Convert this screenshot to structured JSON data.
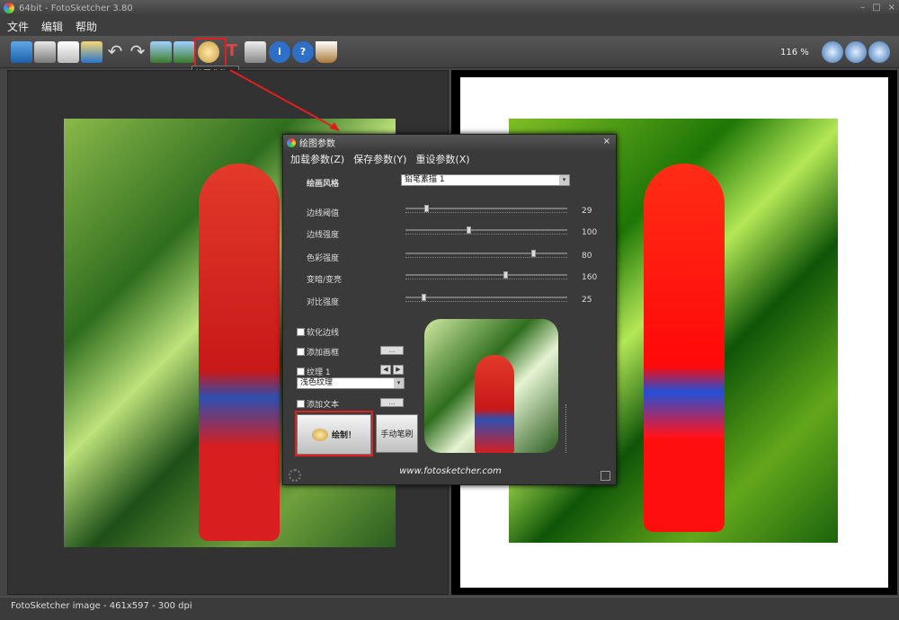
{
  "window": {
    "title": "64bit - FotoSketcher 3.80",
    "minimize": "–",
    "maximize": "□",
    "close": "×"
  },
  "menu": [
    "文件",
    "编辑",
    "帮助"
  ],
  "toolbar": {
    "buttons": [
      "open-icon",
      "save-icon",
      "copy-icon",
      "paste-icon",
      "undo-icon",
      "redo-icon",
      "image-left-icon",
      "image-right-icon",
      "paint-params-icon",
      "text-icon",
      "print-icon",
      "info-icon",
      "help-icon",
      "coffee-icon"
    ],
    "tooltip": "绘图参数...",
    "zoom_label": "116 %",
    "zoom_buttons": [
      "zoom-in-icon",
      "zoom-fit-icon",
      "zoom-out-icon"
    ]
  },
  "status": {
    "text": "FotoSketcher image - 461x597 - 300 dpi"
  },
  "dialog": {
    "title": "绘图参数",
    "close": "×",
    "menu": [
      "加载参数(Z)",
      "保存参数(Y)",
      "重设参数(X)"
    ],
    "style_label": "绘画风格",
    "style_value": "铅笔素描 1",
    "sliders": [
      {
        "label": "边线阈值",
        "value": "29",
        "position": 0.12
      },
      {
        "label": "边线强度",
        "value": "100",
        "position": 0.39
      },
      {
        "label": "色彩强度",
        "value": "80",
        "position": 0.8
      },
      {
        "label": "变暗/变亮",
        "value": "160",
        "position": 0.62
      },
      {
        "label": "对比强度",
        "value": "25",
        "position": 0.1
      }
    ],
    "soften_edges": "软化边线",
    "add_frame": "添加画框",
    "texture": "纹理 1",
    "texture_type": "浅色纹理",
    "add_text": "添加文本",
    "dots_button": "...",
    "paint_button": "绘制！",
    "manual_brush": "手动笔刷",
    "website": "www.fotosketcher.com",
    "prev_arrow": "◀",
    "next_arrow": "▶",
    "dropdown_arrow": "▾"
  },
  "colors": {
    "accent_red": "#e02020",
    "parrot_red": "#d81e1e",
    "foliage": "#2f6e1e"
  }
}
